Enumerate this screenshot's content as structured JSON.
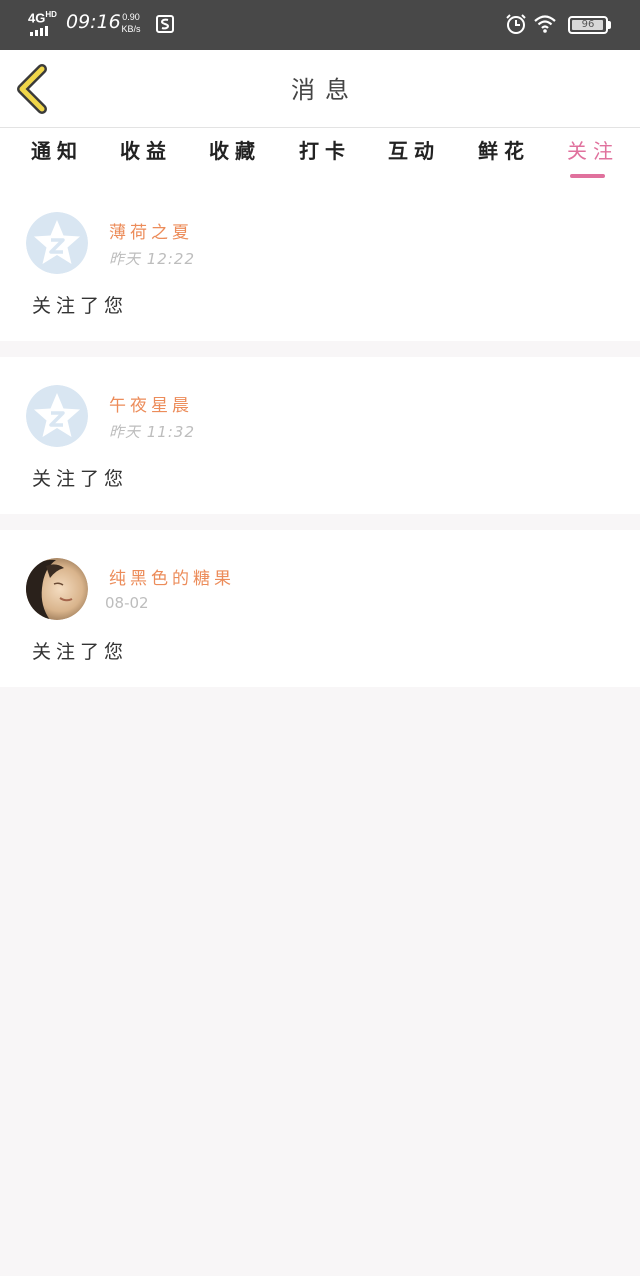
{
  "status_bar": {
    "network": "4G",
    "network_hd": "HD",
    "time": "09:16",
    "speed_value": "0.90",
    "speed_unit": "KB/s",
    "battery": "96",
    "battery_level": 0.96
  },
  "header": {
    "title": "消息"
  },
  "tabs": [
    {
      "label": "通知",
      "active": false
    },
    {
      "label": "收益",
      "active": false
    },
    {
      "label": "收藏",
      "active": false
    },
    {
      "label": "打卡",
      "active": false
    },
    {
      "label": "互动",
      "active": false
    },
    {
      "label": "鲜花",
      "active": false
    },
    {
      "label": "关注",
      "active": true
    }
  ],
  "feed": [
    {
      "user": "薄荷之夏",
      "time": "昨天 12:22",
      "message": "关注了您",
      "avatar": "default-avatar"
    },
    {
      "user": "午夜星晨",
      "time": "昨天 11:32",
      "message": "关注了您",
      "avatar": "default-avatar"
    },
    {
      "user": "纯黑色的糖果",
      "time": "08-02",
      "message": "关注了您",
      "avatar": "photo-avatar"
    }
  ],
  "colors": {
    "accent": "#e0719d",
    "username": "#ec8c5a",
    "back_arrow": "#f0d64a",
    "status_bar": "#484848",
    "page_bg": "#f8f6f7"
  }
}
